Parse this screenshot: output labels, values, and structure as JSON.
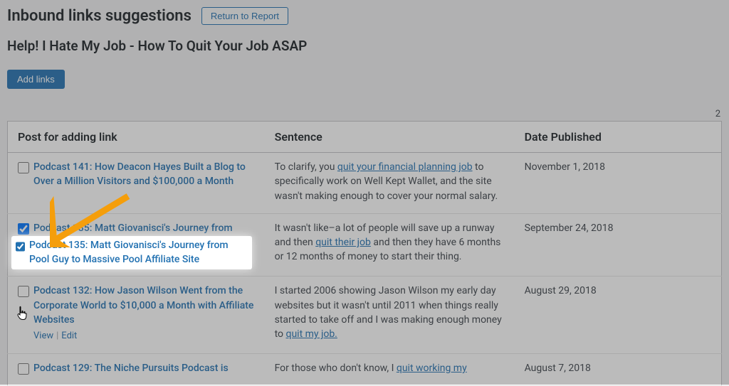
{
  "header": {
    "title": "Inbound links suggestions",
    "return_label": "Return to Report"
  },
  "subtitle": "Help! I Hate My Job - How To Quit Your Job ASAP",
  "buttons": {
    "add_links": "Add links"
  },
  "count": "2",
  "table": {
    "columns": {
      "post": "Post for adding link",
      "sentence": "Sentence",
      "date": "Date Published"
    },
    "rows": [
      {
        "checked": false,
        "title": "Podcast 141: How Deacon Hayes Built a Blog to Over a Million Visitors and $100,000 a Month",
        "sentence_pre": "To clarify, you ",
        "sentence_link": "quit your financial planning job",
        "sentence_post": " to specifically work on Well Kept Wallet, and the site wasn't making enough to cover your normal salary.",
        "date": "November 1, 2018",
        "show_actions": false
      },
      {
        "checked": true,
        "title": "Podcast 135: Matt Giovanisci's Journey from Pool Guy to Massive Pool Affiliate Site",
        "sentence_pre": "It wasn't like–a lot of people will save up a runway and then ",
        "sentence_link": "quit their job",
        "sentence_post": " and then they have 6 months or 12 months of money to start their thing.",
        "date": "September 24, 2018",
        "show_actions": true
      },
      {
        "checked": false,
        "title": "Podcast 132: How Jason Wilson Went from the Corporate World to $10,000 a Month with Affiliate Websites",
        "sentence_pre": "I started 2006 showing Jason Wilson my early day websites but it wasn't until 2011 when things really started to take off and I was making enough money to ",
        "sentence_link": "quit my job.",
        "sentence_post": "",
        "date": "August 29, 2018",
        "show_actions": true
      },
      {
        "checked": false,
        "title": "Podcast 129: The Niche Pursuits Podcast is",
        "sentence_pre": "For those who don't know, I ",
        "sentence_link": "quit working my",
        "sentence_post": "",
        "date": "August 7, 2018",
        "show_actions": false
      }
    ]
  },
  "actions": {
    "view": "View",
    "edit": "Edit"
  }
}
